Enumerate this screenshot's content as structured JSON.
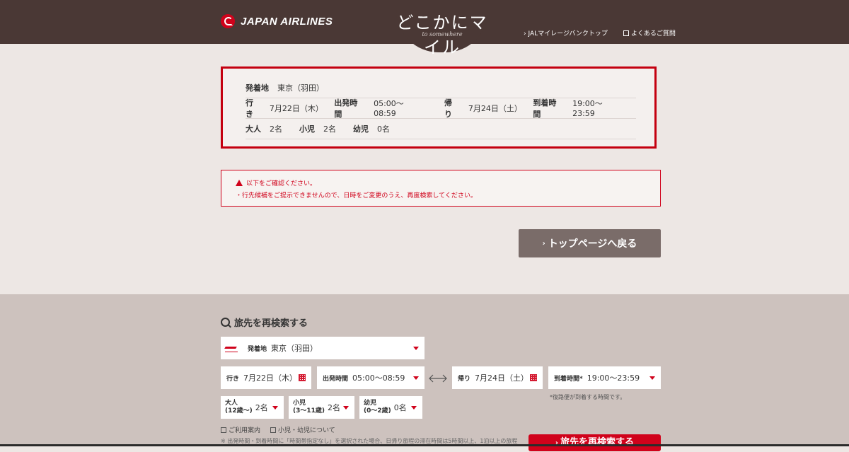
{
  "header": {
    "logo": "JAPAN AIRLINES",
    "brand_title": "どこかにマイル",
    "brand_sub": "to somewhere",
    "links": [
      "JALマイレージバンクトップ",
      "よくあるご質問"
    ]
  },
  "summary": {
    "departure_label": "発着地",
    "departure_value": "東京（羽田）",
    "outbound_label": "行き",
    "outbound_date": "7月22日（木）",
    "dep_time_label": "出発時間",
    "dep_time_value": "05:00〜08:59",
    "return_label": "帰り",
    "return_date": "7月24日（土）",
    "arr_time_label": "到着時間",
    "arr_time_value": "19:00〜23:59",
    "adult_label": "大人",
    "adult_value": "2名",
    "child_label": "小児",
    "child_value": "2名",
    "infant_label": "幼児",
    "infant_value": "0名"
  },
  "error": {
    "title": "以下をご確認ください。",
    "message": "・行先候補をご提示できませんので、日時をご変更のうえ、再度検索してください。"
  },
  "back_button": "トップページへ戻る",
  "search": {
    "heading": "旅先を再検索する",
    "departure_label": "発着地",
    "departure_value": "東京（羽田）",
    "outbound_label": "行き",
    "outbound_value": "7月22日（木）",
    "dep_time_label": "出発時間",
    "dep_time_value": "05:00〜08:59",
    "return_label": "帰り",
    "return_value": "7月24日（土）",
    "arr_time_label": "到着時間*",
    "arr_time_value": "19:00〜23:59",
    "arr_note": "*復路便が到着する時間です。",
    "adult_label": "大人",
    "adult_age": "(12歳〜)",
    "adult_value": "2名",
    "child_label": "小児",
    "child_age": "(3〜11歳)",
    "child_value": "2名",
    "infant_label": "幼児",
    "infant_age": "(0〜2歳)",
    "infant_value": "0名",
    "link_guide": "ご利用案内",
    "link_child": "小児・幼児について",
    "note": "※ 出発時間・到着時間に「時間帯指定なし」を選択された場合、日帰り旅程の滞在時間は5時間以上、1泊以上の旅程の",
    "submit": "旅先を再検索する"
  },
  "colors": {
    "accent": "#d0021b",
    "header_bg": "#4a3835"
  }
}
